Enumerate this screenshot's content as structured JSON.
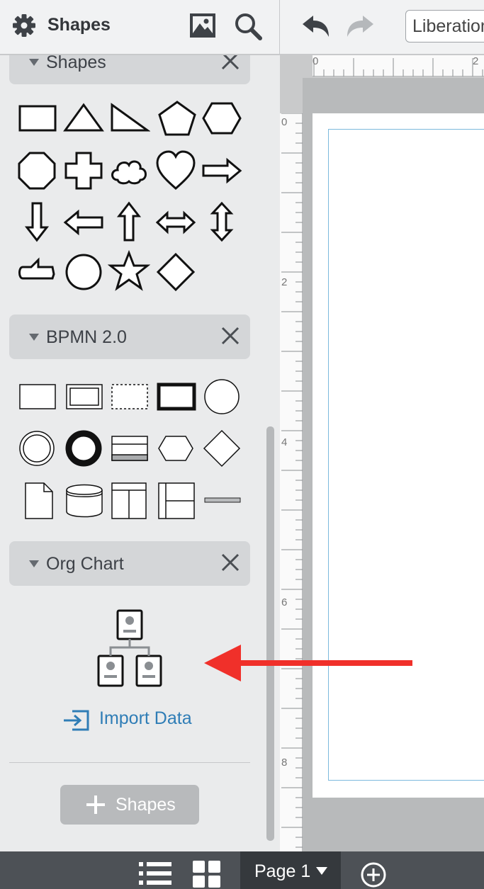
{
  "toolbar": {
    "title": "Shapes",
    "font_value": "Liberation Sans",
    "icons": [
      "gear-icon",
      "image-icon",
      "search-icon",
      "undo-icon",
      "redo-icon"
    ]
  },
  "panels": [
    {
      "title": "Shapes",
      "shapes": [
        "rectangle",
        "triangle",
        "right-triangle",
        "pentagon",
        "hexagon",
        "octagon",
        "cross",
        "cloud",
        "heart",
        "arrow-right",
        "arrow-down",
        "arrow-left",
        "arrow-up",
        "arrow-left-right",
        "arrow-up-down",
        "callout",
        "circle",
        "star",
        "diamond"
      ]
    },
    {
      "title": "BPMN 2.0",
      "shapes": [
        "task",
        "subprocess",
        "transaction",
        "call-activity",
        "start-event",
        "intermediate-event",
        "end-event",
        "pool",
        "conditional",
        "gateway",
        "data-object",
        "data-store",
        "lane-vertical",
        "lane-horizontal",
        "association"
      ]
    },
    {
      "title": "Org Chart"
    }
  ],
  "org_chart": {
    "import_label": "Import Data"
  },
  "add_shapes_label": "Shapes",
  "ruler": {
    "top": [
      "0",
      "2"
    ],
    "left": [
      "0",
      "2",
      "4",
      "6",
      "8"
    ]
  },
  "bottom": {
    "page_label": "Page 1"
  },
  "colors": {
    "accent": "#2f7db6",
    "annotation_arrow": "#f0302a",
    "bottom_bar": "#4d5156"
  }
}
